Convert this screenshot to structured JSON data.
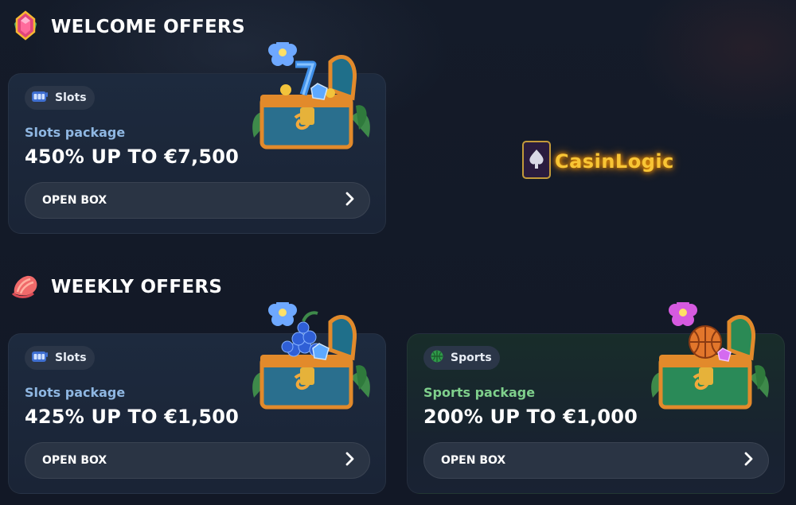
{
  "sections": {
    "welcome": {
      "title": "WELCOME OFFERS"
    },
    "weekly": {
      "title": "WEEKLY OFFERS"
    }
  },
  "cards": {
    "welcome_slots": {
      "chip": "Slots",
      "package": "Slots package",
      "amount": "450% UP TO €7,500",
      "button": "OPEN BOX"
    },
    "weekly_slots": {
      "chip": "Slots",
      "package": "Slots package",
      "amount": "425% UP TO €1,500",
      "button": "OPEN BOX"
    },
    "weekly_sports": {
      "chip": "Sports",
      "package": "Sports package",
      "amount": "200% UP TO €1,000",
      "button": "OPEN BOX"
    }
  },
  "watermark": {
    "text": "CasinLogic"
  },
  "icons": {
    "welcome": "gem-icon",
    "weekly": "shell-icon",
    "slots_chip": "slot-machine-icon",
    "sports_chip": "ball-icon",
    "button": "chevron-right-icon"
  },
  "colors": {
    "background": "#131a27",
    "card": "#1d2a3e",
    "button": "#2a3444",
    "slots_package": "#8fb7e2",
    "sports_package": "#7fd08c",
    "logo": "#f8c535"
  }
}
